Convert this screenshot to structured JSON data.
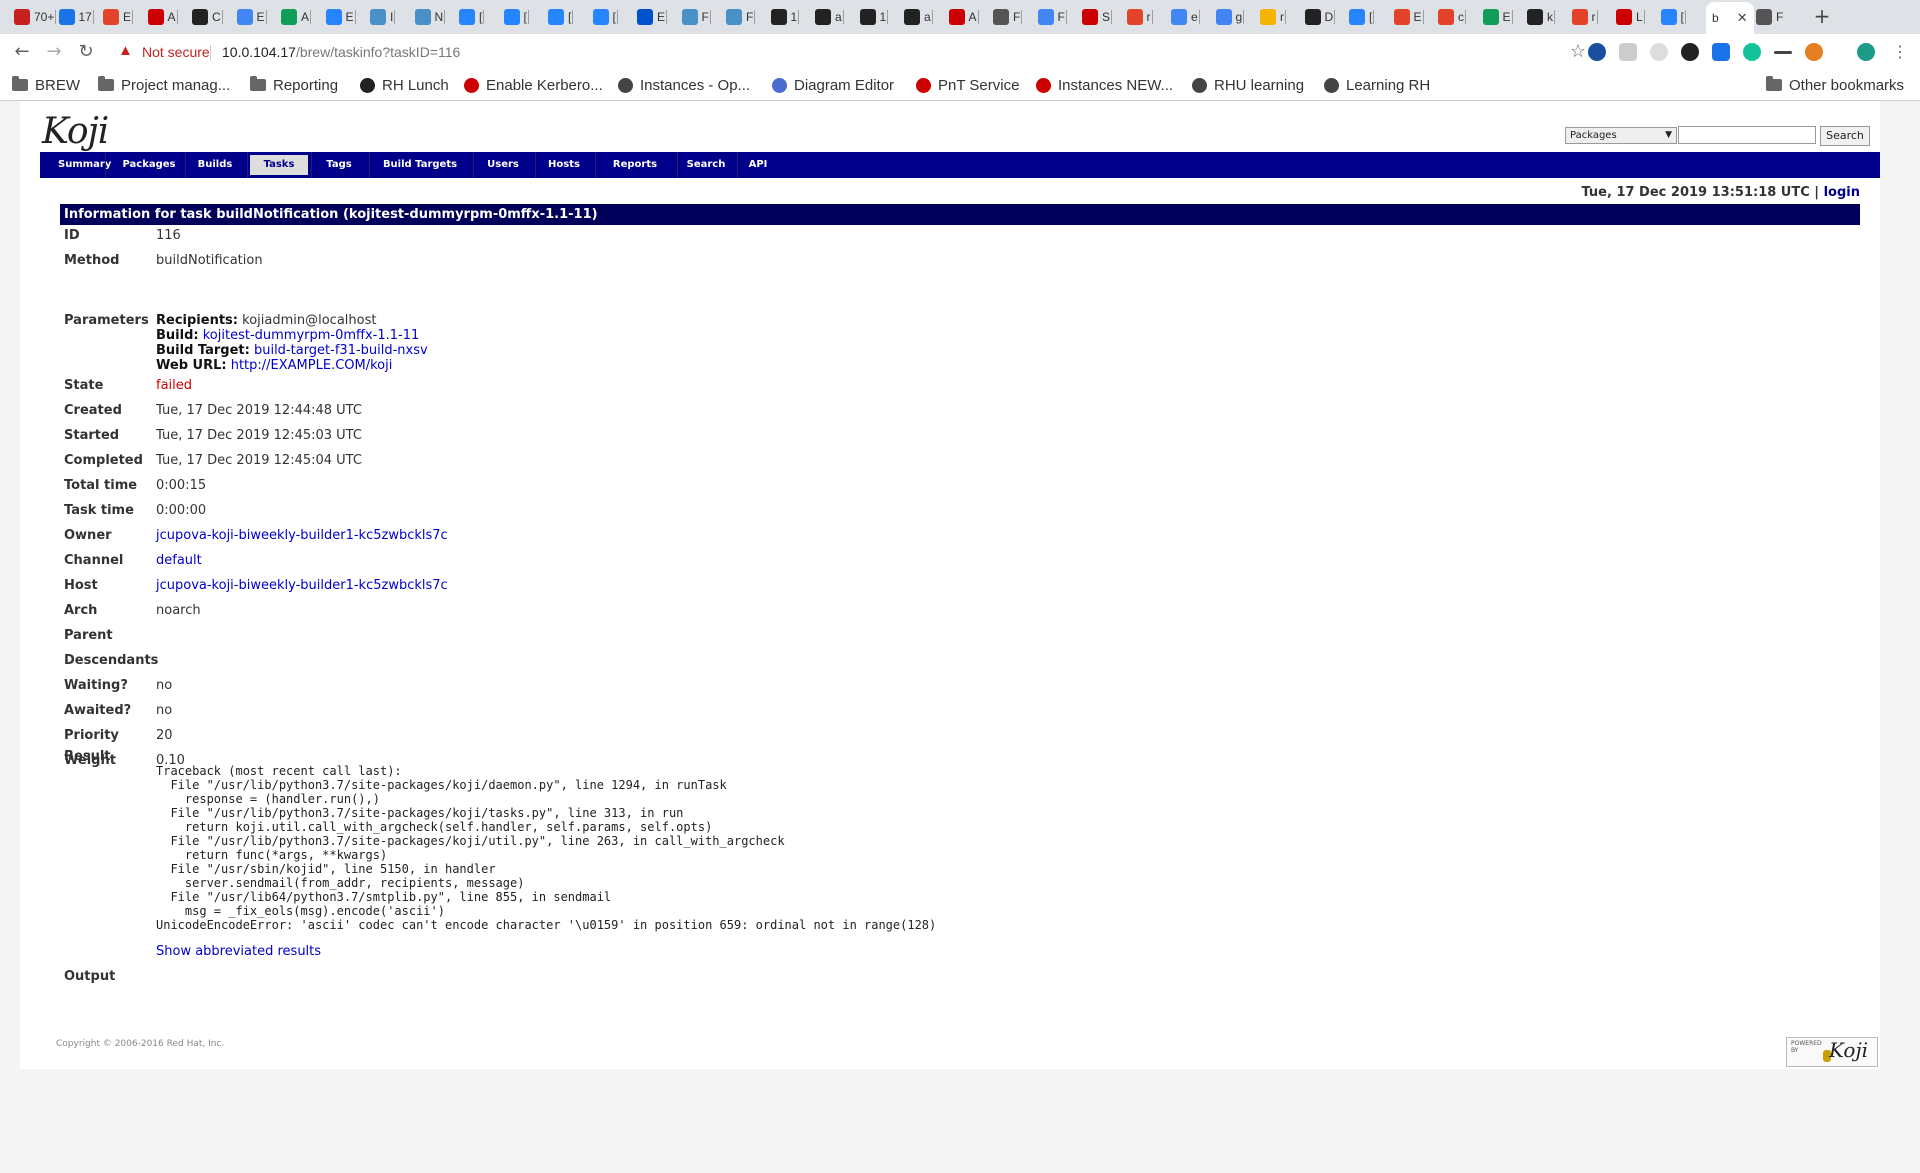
{
  "browser": {
    "tabs": [
      {
        "label": "70+",
        "color": "#c5221f"
      },
      {
        "label": "17",
        "color": "#1a73e8"
      },
      {
        "label": "E",
        "color": "#e24329"
      },
      {
        "label": "A",
        "color": "#c00"
      },
      {
        "label": "C",
        "color": "#222"
      },
      {
        "label": "E",
        "color": "#4285f4"
      },
      {
        "label": "A",
        "color": "#0f9d58"
      },
      {
        "label": "E",
        "color": "#2684ff"
      },
      {
        "label": "I",
        "color": "#4a90c8"
      },
      {
        "label": "N",
        "color": "#4a90c8"
      },
      {
        "label": "[",
        "color": "#2684ff"
      },
      {
        "label": "[",
        "color": "#2684ff"
      },
      {
        "label": "[",
        "color": "#2684ff"
      },
      {
        "label": "[",
        "color": "#2684ff"
      },
      {
        "label": "E",
        "color": "#0052cc"
      },
      {
        "label": "F",
        "color": "#4a90c8"
      },
      {
        "label": "F",
        "color": "#4a90c8"
      },
      {
        "label": "1",
        "color": "#222"
      },
      {
        "label": "a",
        "color": "#222"
      },
      {
        "label": "1",
        "color": "#222"
      },
      {
        "label": "a",
        "color": "#222"
      },
      {
        "label": "A",
        "color": "#c00"
      },
      {
        "label": "F",
        "color": "#555"
      },
      {
        "label": "F",
        "color": "#4285f4"
      },
      {
        "label": "S",
        "color": "#c00"
      },
      {
        "label": "r",
        "color": "#e24329"
      },
      {
        "label": "e",
        "color": "#4285f4"
      },
      {
        "label": "g",
        "color": "#4285f4"
      },
      {
        "label": "r",
        "color": "#f4b400"
      },
      {
        "label": "D",
        "color": "#222"
      },
      {
        "label": "[",
        "color": "#2684ff"
      },
      {
        "label": "E",
        "color": "#e24329"
      },
      {
        "label": "c",
        "color": "#e24329"
      },
      {
        "label": "E",
        "color": "#0f9d58"
      },
      {
        "label": "k",
        "color": "#222"
      },
      {
        "label": "r",
        "color": "#e24329"
      },
      {
        "label": "L",
        "color": "#c00"
      },
      {
        "label": "[",
        "color": "#2684ff"
      }
    ],
    "active_tab": {
      "label": "b",
      "close": "✕"
    },
    "last_tab": {
      "label": "F"
    },
    "new_tab": "+",
    "nav": {
      "back": "←",
      "forward": "→",
      "reload": "↻"
    },
    "security": {
      "icon": "▲",
      "text": "Not secure"
    },
    "url": {
      "host": "10.0.104.17",
      "path": "/brew/taskinfo?taskID=116"
    },
    "bookmarks": [
      {
        "label": "BREW",
        "type": "folder"
      },
      {
        "label": "Project manag...",
        "type": "folder"
      },
      {
        "label": "Reporting",
        "type": "folder"
      },
      {
        "label": "RH Lunch",
        "type": "site",
        "color": "#222"
      },
      {
        "label": "Enable Kerbero...",
        "type": "site",
        "color": "#c00"
      },
      {
        "label": "Instances - Op...",
        "type": "site",
        "color": "#444"
      },
      {
        "label": "Diagram Editor",
        "type": "site",
        "color": "#4a6cd0"
      },
      {
        "label": "PnT Service",
        "type": "site",
        "color": "#c00"
      },
      {
        "label": "Instances NEW...",
        "type": "site",
        "color": "#c00"
      },
      {
        "label": "RHU learning",
        "type": "site",
        "color": "#444"
      },
      {
        "label": "Learning RH",
        "type": "site",
        "color": "#444"
      }
    ],
    "other_bookmarks": "Other bookmarks"
  },
  "koji": {
    "logo": "Koji",
    "search": {
      "select_value": "Packages",
      "button": "Search"
    },
    "nav": [
      "Summary",
      "Packages",
      "Builds",
      "Tasks",
      "Tags",
      "Build Targets",
      "Users",
      "Hosts",
      "Reports",
      "Search",
      "API"
    ],
    "active_nav": "Tasks",
    "datetime": "Tue, 17 Dec 2019 13:51:18 UTC",
    "login": "login",
    "header": "Information for task buildNotification (kojitest-dummyrpm-0mffx-1.1-11)",
    "fields": {
      "id": {
        "label": "ID",
        "value": "116"
      },
      "method": {
        "label": "Method",
        "value": "buildNotification"
      },
      "parameters": {
        "label": "Parameters",
        "recipients_label": "Recipients:",
        "recipients": "kojiadmin@localhost",
        "build_label": "Build:",
        "build": "kojitest-dummyrpm-0mffx-1.1-11",
        "target_label": "Build Target:",
        "target": "build-target-f31-build-nxsv",
        "weburl_label": "Web URL:",
        "weburl": "http://EXAMPLE.COM/koji"
      },
      "state": {
        "label": "State",
        "value": "failed"
      },
      "created": {
        "label": "Created",
        "value": "Tue, 17 Dec 2019 12:44:48 UTC"
      },
      "started": {
        "label": "Started",
        "value": "Tue, 17 Dec 2019 12:45:03 UTC"
      },
      "completed": {
        "label": "Completed",
        "value": "Tue, 17 Dec 2019 12:45:04 UTC"
      },
      "total_time": {
        "label": "Total time",
        "value": "0:00:15"
      },
      "task_time": {
        "label": "Task time",
        "value": "0:00:00"
      },
      "owner": {
        "label": "Owner",
        "value": "jcupova-koji-biweekly-builder1-kc5zwbckls7c"
      },
      "channel": {
        "label": "Channel",
        "value": "default"
      },
      "host": {
        "label": "Host",
        "value": "jcupova-koji-biweekly-builder1-kc5zwbckls7c"
      },
      "arch": {
        "label": "Arch",
        "value": "noarch"
      },
      "parent": {
        "label": "Parent",
        "value": ""
      },
      "descendants": {
        "label": "Descendants",
        "value": ""
      },
      "waiting": {
        "label": "Waiting?",
        "value": "no"
      },
      "awaited": {
        "label": "Awaited?",
        "value": "no"
      },
      "priority": {
        "label": "Priority",
        "value": "20"
      },
      "weight": {
        "label": "Weight",
        "value": "0.10"
      },
      "result": {
        "label": "Result",
        "traceback": "Traceback (most recent call last):\n  File \"/usr/lib/python3.7/site-packages/koji/daemon.py\", line 1294, in runTask\n    response = (handler.run(),)\n  File \"/usr/lib/python3.7/site-packages/koji/tasks.py\", line 313, in run\n    return koji.util.call_with_argcheck(self.handler, self.params, self.opts)\n  File \"/usr/lib/python3.7/site-packages/koji/util.py\", line 263, in call_with_argcheck\n    return func(*args, **kwargs)\n  File \"/usr/sbin/kojid\", line 5150, in handler\n    server.sendmail(from_addr, recipients, message)\n  File \"/usr/lib64/python3.7/smtplib.py\", line 855, in sendmail\n    msg = _fix_eols(msg).encode('ascii')\nUnicodeEncodeError: 'ascii' codec can't encode character '\\u0159' in position 659: ordinal not in range(128)",
        "show_link": "Show abbreviated results"
      },
      "output": {
        "label": "Output",
        "value": ""
      }
    },
    "copyright": "Copyright © 2006-2016 Red Hat, Inc.",
    "powered_by": "POWERED BY",
    "powered_logo": "Koji"
  }
}
